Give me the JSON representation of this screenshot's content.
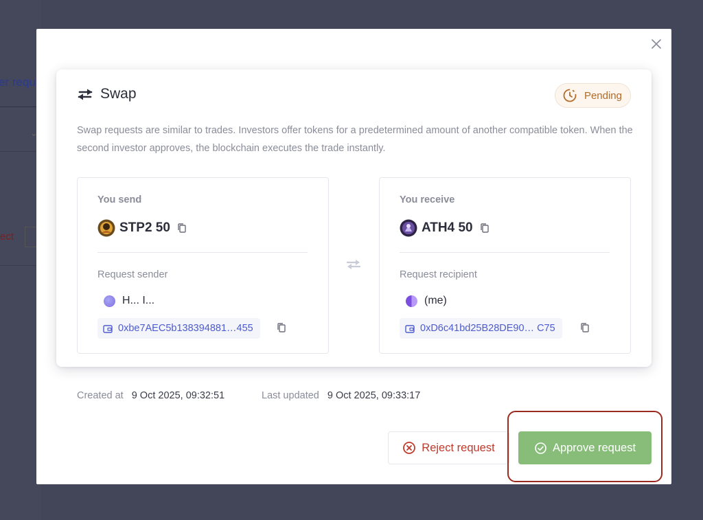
{
  "background": {
    "partial_tab_text": "er requ",
    "partial_reject_text": "ect"
  },
  "modal": {
    "title": "Swap",
    "status": "Pending",
    "description": "Swap requests are similar to trades. Investors offer tokens for a predetermined amount of another compatible token. When the second investor approves, the blockchain executes the trade instantly.",
    "send": {
      "heading": "You send",
      "token": "STP2 50",
      "party_label": "Request sender",
      "party_name": "H... I...",
      "address": "0xbe7AEC5b138394881…455"
    },
    "receive": {
      "heading": "You receive",
      "token": "ATH4 50",
      "party_label": "Request recipient",
      "party_name": "(me)",
      "address": "0xD6c41bd25B28DE90… C75"
    },
    "created_label": "Created at",
    "created_value": "9 Oct 2025, 09:32:51",
    "updated_label": "Last updated",
    "updated_value": "9 Oct 2025, 09:33:17",
    "reject_label": "Reject request",
    "approve_label": "Approve request"
  },
  "colors": {
    "backdrop": "#434559",
    "pending": "#b36b28",
    "reject": "#c0392b",
    "approve": "#87bd79",
    "address_link": "#4d5bd0",
    "highlight": "#9b2a1f"
  },
  "icons": {
    "close": "close-icon",
    "swap": "swap-arrows-icon",
    "pending": "clock-icon",
    "copy": "copy-icon",
    "wallet": "wallet-icon",
    "reject": "x-circle-icon",
    "approve": "check-circle-icon"
  }
}
